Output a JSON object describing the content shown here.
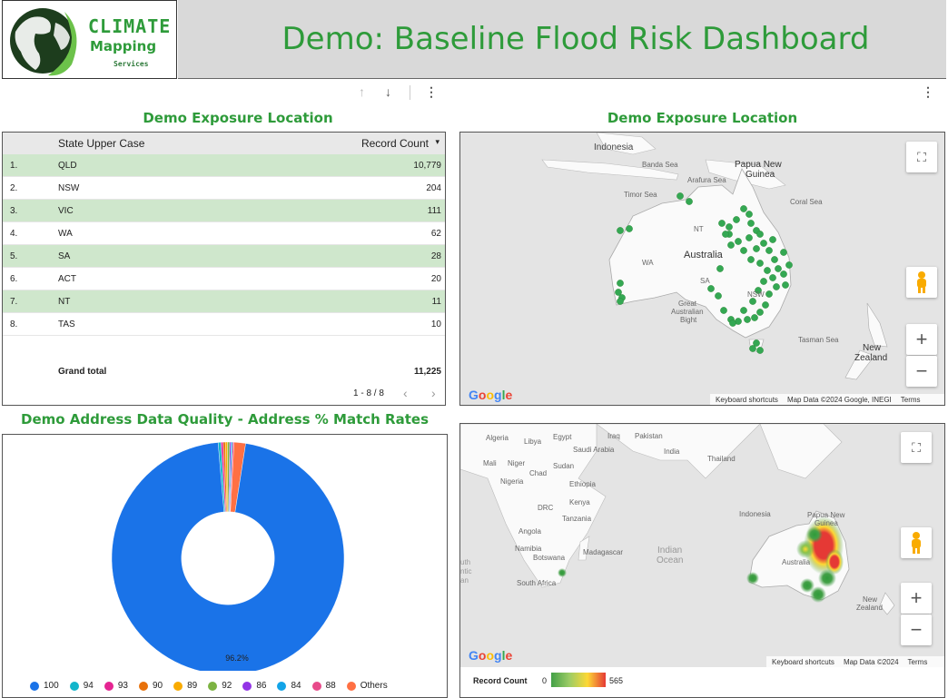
{
  "header": {
    "title": "Demo: Baseline Flood Risk Dashboard",
    "logo_climate": "CLIMATE",
    "logo_mapping": "Mapping",
    "logo_services": "Services"
  },
  "table_panel": {
    "title": "Demo Exposure Location",
    "col_state": "State Upper Case",
    "col_count": "Record Count",
    "rows": [
      {
        "idx": "1.",
        "state": "QLD",
        "count": "10,779"
      },
      {
        "idx": "2.",
        "state": "NSW",
        "count": "204"
      },
      {
        "idx": "3.",
        "state": "VIC",
        "count": "111"
      },
      {
        "idx": "4.",
        "state": "WA",
        "count": "62"
      },
      {
        "idx": "5.",
        "state": "SA",
        "count": "28"
      },
      {
        "idx": "6.",
        "state": "ACT",
        "count": "20"
      },
      {
        "idx": "7.",
        "state": "NT",
        "count": "11"
      },
      {
        "idx": "8.",
        "state": "TAS",
        "count": "10"
      }
    ],
    "grand_total_label": "Grand total",
    "grand_total_value": "11,225",
    "pagination": "1 - 8 / 8"
  },
  "map1": {
    "title": "Demo Exposure Location",
    "labels": {
      "indonesia": "Indonesia",
      "papua": "Papua New",
      "guinea": "Guinea",
      "australia": "Australia",
      "wa": "WA",
      "nt": "NT",
      "sa": "SA",
      "nsw": "NSW",
      "nz1": "New",
      "nz2": "Zealand",
      "tasman": "Tasman Sea",
      "coral": "Coral Sea",
      "banda": "Banda Sea",
      "timor": "Timor Sea",
      "arafura": "Arafura Sea",
      "bight1": "Great",
      "bight2": "Australian",
      "bight3": "Bight"
    },
    "footer_shortcuts": "Keyboard shortcuts",
    "footer_data": "Map Data ©2024 Google, INEGI",
    "footer_terms": "Terms",
    "google": "Google"
  },
  "map2": {
    "labels": {
      "algeria": "Algeria",
      "libya": "Libya",
      "egypt": "Egypt",
      "iraq": "Iraq",
      "pakistan": "Pakistan",
      "saudi": "Saudi Arabia",
      "india": "India",
      "thailand": "Thailand",
      "mali": "Mali",
      "niger": "Niger",
      "chad": "Chad",
      "sudan": "Sudan",
      "nigeria": "Nigeria",
      "ethiopia": "Ethiopia",
      "drc": "DRC",
      "kenya": "Kenya",
      "tanzania": "Tanzania",
      "angola": "Angola",
      "namibia": "Namibia",
      "botswana": "Botswana",
      "madagascar": "Madagascar",
      "southafrica": "South Africa",
      "indian1": "Indian",
      "indian2": "Ocean",
      "indonesia": "Indonesia",
      "papua": "Papua New",
      "guinea": "Guinea",
      "australia": "Australia",
      "nz1": "New",
      "nz2": "Zealand",
      "atl1": "uth",
      "atl2": "ntic",
      "atl3": "an"
    },
    "footer_shortcuts": "Keyboard shortcuts",
    "footer_data": "Map Data ©2024",
    "footer_terms": "Terms",
    "google": "Google",
    "heat_legend_label": "Record Count",
    "heat_min": "0",
    "heat_max": "565"
  },
  "donut_panel": {
    "title": "Demo Address Data Quality - Address % Match Rates",
    "center_label": "96.2%"
  },
  "chart_data": {
    "type": "pie",
    "title": "Demo Address Data Quality - Address % Match Rates",
    "categories": [
      "100",
      "94",
      "93",
      "90",
      "89",
      "92",
      "86",
      "84",
      "88",
      "Others"
    ],
    "values": [
      96.2,
      0.4,
      0.3,
      0.3,
      0.3,
      0.3,
      0.2,
      0.2,
      0.2,
      1.6
    ],
    "colors": [
      "#1a73e8",
      "#12b5cb",
      "#e52592",
      "#e8710a",
      "#f9ab00",
      "#7cb342",
      "#9334e6",
      "#12a4e8",
      "#e84a8a",
      "#ff7043"
    ],
    "hole": 0.4,
    "legend": "bottom"
  },
  "colors": {
    "accent_green": "#2e9b3a",
    "row_highlight": "#cfe7cc"
  }
}
